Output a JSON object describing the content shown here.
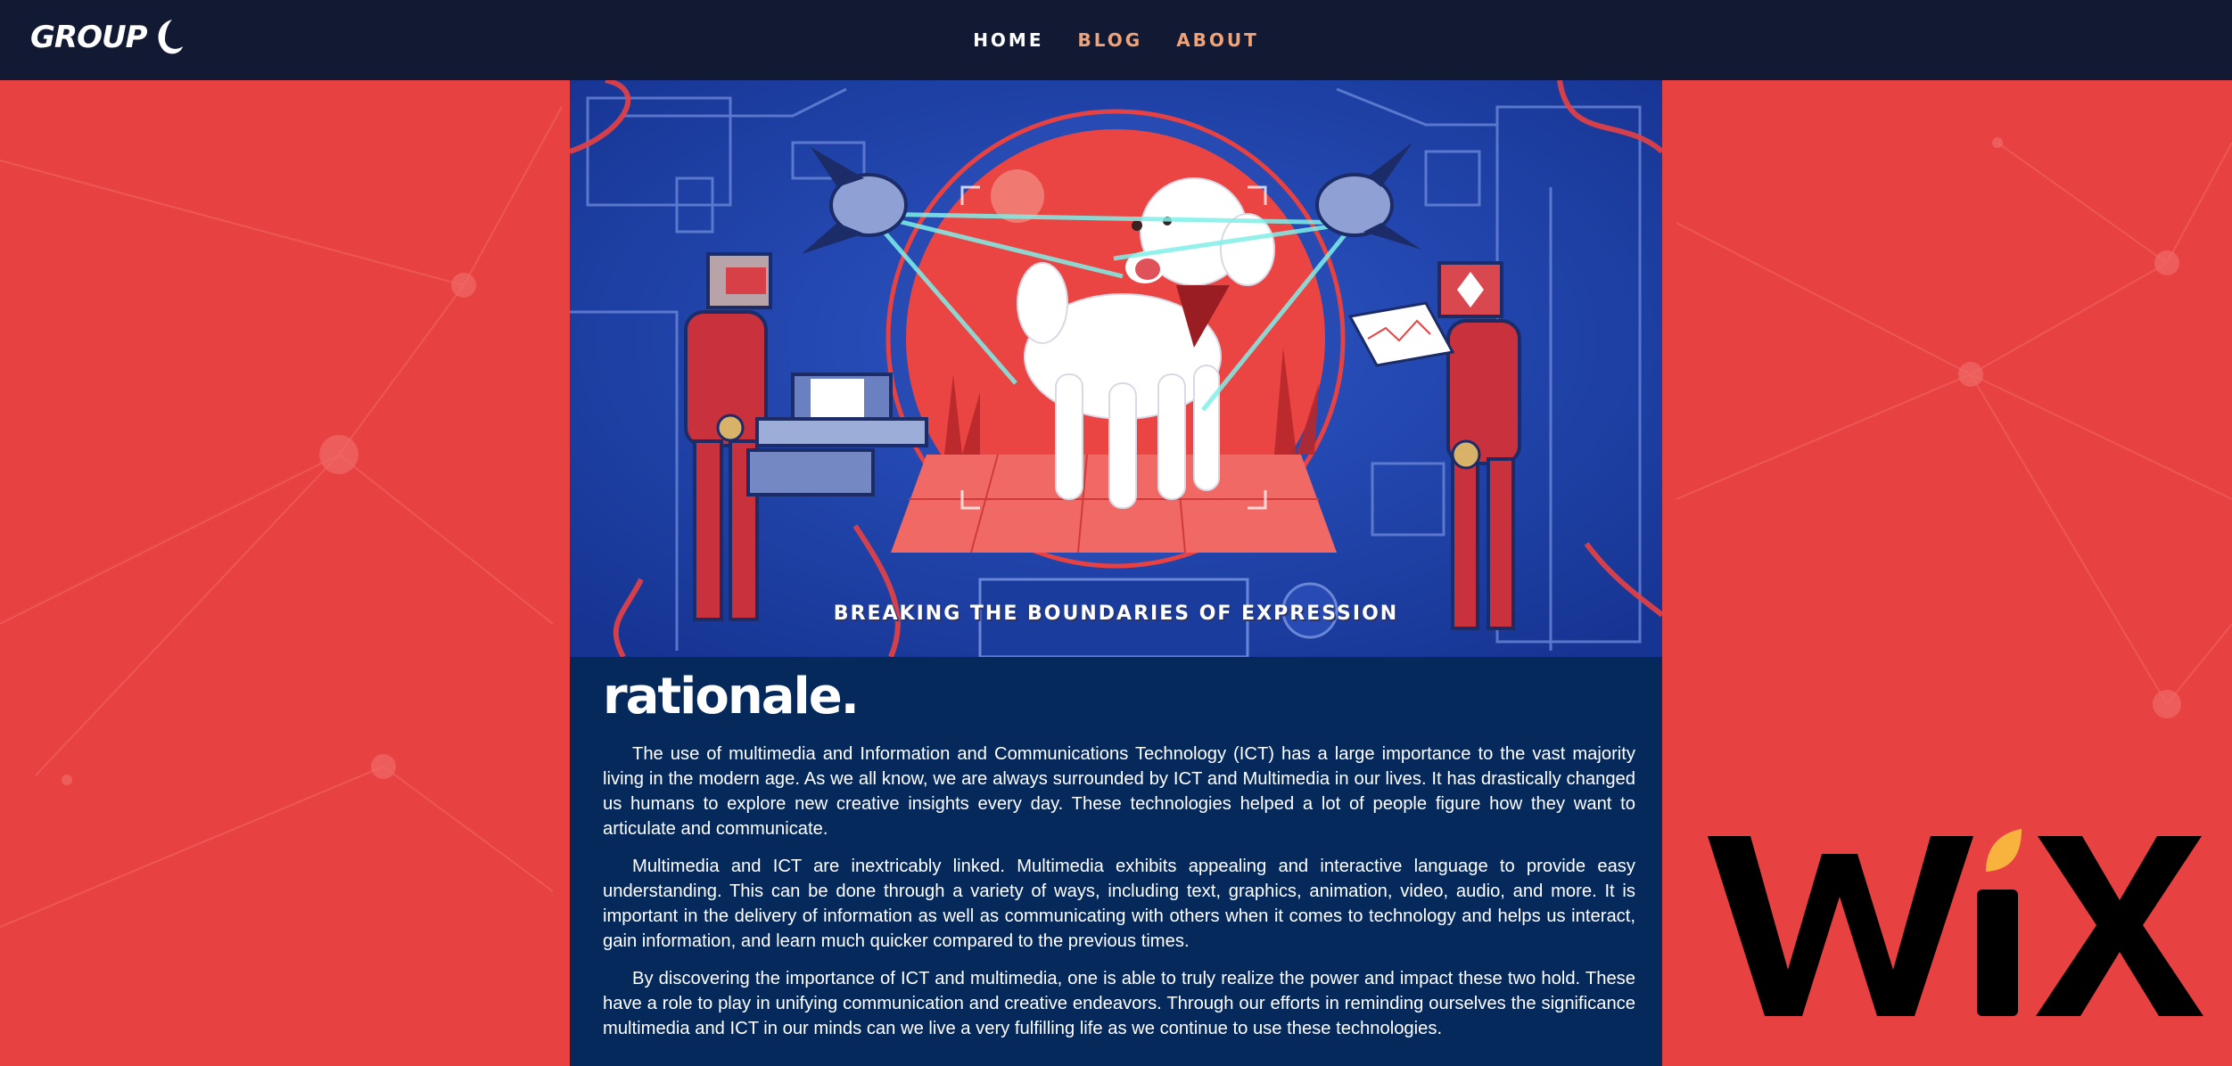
{
  "header": {
    "logo_text": "GROUP",
    "logo_icon": "crescent-6-mark",
    "nav": [
      {
        "label": "HOME",
        "active": true
      },
      {
        "label": "BLOG",
        "active": false
      },
      {
        "label": "ABOUT",
        "active": false
      }
    ]
  },
  "hero": {
    "caption": "BREAKING THE BOUNDARIES OF EXPRESSION",
    "illustration": "robots-scanning-white-dog"
  },
  "article": {
    "title": "rationale.",
    "paragraphs": [
      "The use of multimedia and Information and Communications Technology (ICT) has a large importance to the vast majority living in the modern age. As we all know, we are always surrounded by ICT and Multimedia in our lives. It has drastically changed us humans to explore new creative insights every day. These technologies helped a lot of people figure how they want to articulate and communicate.",
      "Multimedia and ICT are inextricably linked. Multimedia exhibits appealing and interactive language to provide easy understanding. This can be done through a variety of ways, including text, graphics, animation, video, audio, and more. It is important in the delivery of information as well as communicating with others when it comes to technology and helps us interact, gain information, and learn much quicker compared to the previous times.",
      "By discovering the importance of ICT and multimedia, one is able to truly realize the power and impact these two hold. These have a role to play in unifying communication and creative endeavors. Through our efforts in reminding ourselves the significance multimedia and ICT in our minds can we live a very fulfilling life as we continue to use these technologies."
    ]
  },
  "badge": {
    "text": "WIX",
    "icon": "wix-logo"
  },
  "colors": {
    "page_bg": "#e84142",
    "header_bg": "#121a33",
    "column_bg": "#06295b",
    "nav_active": "#ffffff",
    "nav_inactive": "#f1a276",
    "wix_accent": "#f7b33d"
  }
}
